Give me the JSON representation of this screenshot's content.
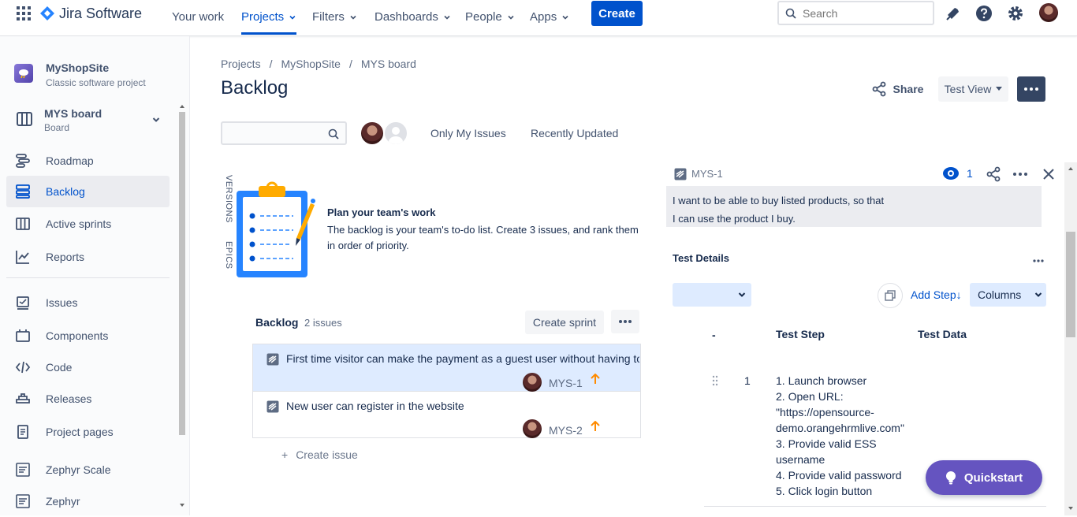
{
  "topnav": {
    "product": "Jira Software",
    "items": [
      {
        "label": "Your work"
      },
      {
        "label": "Projects"
      },
      {
        "label": "Filters"
      },
      {
        "label": "Dashboards"
      },
      {
        "label": "People"
      },
      {
        "label": "Apps"
      }
    ],
    "create_label": "Create",
    "search_placeholder": "Search"
  },
  "sidebar": {
    "project_name": "MyShopSite",
    "project_type": "Classic software project",
    "board_name": "MYS board",
    "board_type": "Board",
    "items": [
      {
        "label": "Roadmap"
      },
      {
        "label": "Backlog"
      },
      {
        "label": "Active sprints"
      },
      {
        "label": "Reports"
      },
      {
        "label": "Issues"
      },
      {
        "label": "Components"
      },
      {
        "label": "Code"
      },
      {
        "label": "Releases"
      },
      {
        "label": "Project pages"
      },
      {
        "label": "Zephyr Scale"
      },
      {
        "label": "Zephyr"
      }
    ]
  },
  "main": {
    "breadcrumb": [
      "Projects",
      "MyShopSite",
      "MYS board"
    ],
    "title": "Backlog",
    "share_label": "Share",
    "view_label": "Test View",
    "filters": {
      "only_my_issues": "Only My Issues",
      "recently_updated": "Recently Updated"
    },
    "side_tabs": {
      "versions": "VERSIONS",
      "epics": "EPICS"
    },
    "empty_state": {
      "heading": "Plan your team's work",
      "body": "The backlog is your team's to-do list. Create 3 issues, and rank them in order of priority."
    },
    "backlog": {
      "label": "Backlog",
      "count": "2 issues",
      "create_sprint_label": "Create sprint",
      "create_issue_label": "Create issue",
      "issues": [
        {
          "summary": "First time visitor can make the payment as a guest user without having to",
          "key": "MYS-1"
        },
        {
          "summary": "New user can register in the website",
          "key": "MYS-2"
        }
      ]
    }
  },
  "detail": {
    "issue_key": "MYS-1",
    "watch_count": "1",
    "description_lines": [
      "I want to be able to buy listed products, so that",
      "I can use the product I buy."
    ],
    "section_title": "Test Details",
    "add_step_label": "Add Step↓",
    "columns_label": "Columns",
    "table": {
      "headers": [
        "-",
        "Test Step",
        "Test Data"
      ],
      "rows": [
        {
          "index": "1",
          "step_lines": [
            "1. Launch browser",
            "2. Open URL:",
            "\"https://opensource-",
            "demo.orangehrmlive.com\"",
            "3. Provide valid ESS",
            "username",
            "4. Provide valid password",
            "5. Click login button"
          ],
          "data": ""
        }
      ]
    },
    "quickstart_label": "Quickstart"
  },
  "colors": {
    "brand": "#0052CC",
    "quickstart": "#6554C0",
    "selected_row": "#DEEBFF",
    "priority": "#FF8B00"
  }
}
